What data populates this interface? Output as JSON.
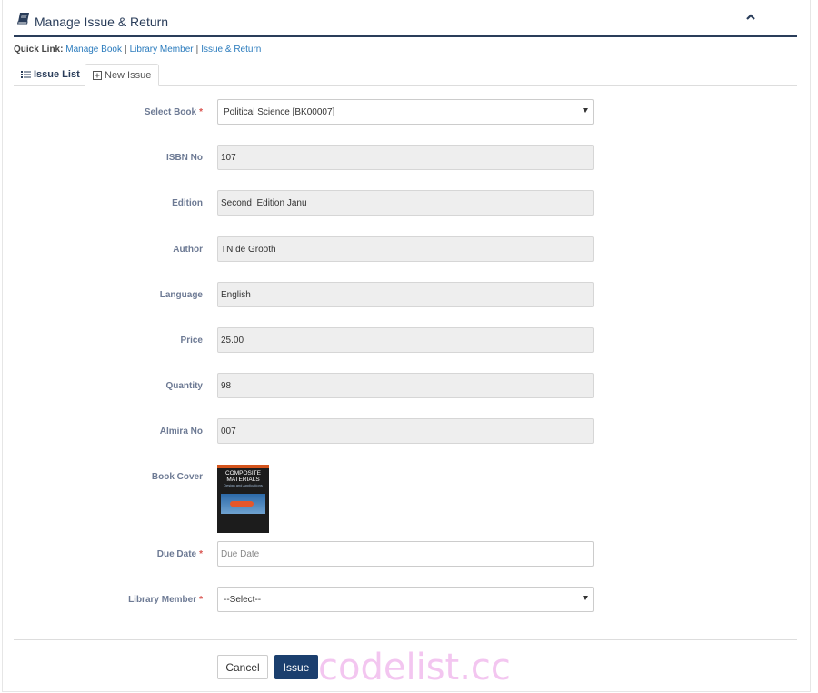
{
  "header": {
    "title": "Manage Issue & Return"
  },
  "quick_link": {
    "label": "Quick Link:",
    "links": [
      "Manage Book",
      "Library Member",
      "Issue & Return"
    ],
    "separator": "|"
  },
  "tabs": [
    {
      "label": "Issue List"
    },
    {
      "label": "New Issue"
    }
  ],
  "form": {
    "select_book": {
      "label": "Select Book",
      "required": "*",
      "value": "Political Science [BK00007]"
    },
    "isbn": {
      "label": "ISBN No",
      "value": "107"
    },
    "edition": {
      "label": "Edition",
      "value": "Second  Edition Janu"
    },
    "author": {
      "label": "Author",
      "value": "TN de Grooth"
    },
    "language": {
      "label": "Language",
      "value": "English"
    },
    "price": {
      "label": "Price",
      "value": "25.00"
    },
    "quantity": {
      "label": "Quantity",
      "value": "98"
    },
    "almira": {
      "label": "Almira No",
      "value": "007"
    },
    "book_cover": {
      "label": "Book Cover",
      "cover_title": "COMPOSITE MATERIALS",
      "cover_subtitle": "Design and Applications"
    },
    "due_date": {
      "label": "Due Date",
      "required": "*",
      "placeholder": "Due Date"
    },
    "library_member": {
      "label": "Library Member",
      "required": "*",
      "value": "--Select--"
    }
  },
  "buttons": {
    "cancel": "Cancel",
    "issue": "Issue"
  },
  "watermark": "codelist.cc",
  "colors": {
    "brand": "#2a3d5a",
    "link": "#2a7bbd",
    "primary_button": "#1b3f6e",
    "required": "#d9534f"
  }
}
